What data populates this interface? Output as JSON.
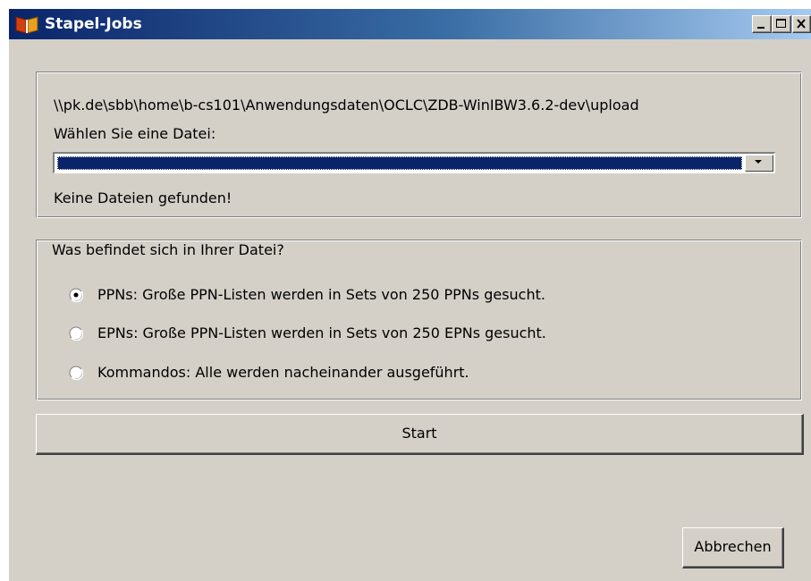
{
  "window": {
    "title": "Stapel-Jobs",
    "icon": "book-icon",
    "controls": {
      "minimize": "minimize-icon",
      "maximize": "maximize-icon",
      "close": "close-icon"
    }
  },
  "file_section": {
    "path": "\\\\pk.de\\sbb\\home\\b-cs101\\Anwendungsdaten\\OCLC\\ZDB-WinIBW3.6.2-dev\\upload",
    "choose_label": "Wählen Sie eine Datei:",
    "selected_file": "",
    "no_files_message": "Keine Dateien gefunden!"
  },
  "content_section": {
    "legend": "Was befindet sich in Ihrer Datei?",
    "options": [
      {
        "label": "PPNs: Große PPN-Listen werden in Sets von 250 PPNs gesucht.",
        "selected": true
      },
      {
        "label": "EPNs: Große PPN-Listen werden in Sets von 250 EPNs gesucht.",
        "selected": false
      },
      {
        "label": "Kommandos: Alle werden nacheinander ausgeführt.",
        "selected": false
      }
    ]
  },
  "buttons": {
    "start": "Start",
    "cancel": "Abbrechen"
  },
  "colors": {
    "face": "#d4d0c8",
    "title_start": "#0a246a",
    "title_end": "#a6caf0",
    "selection": "#0a246a"
  }
}
